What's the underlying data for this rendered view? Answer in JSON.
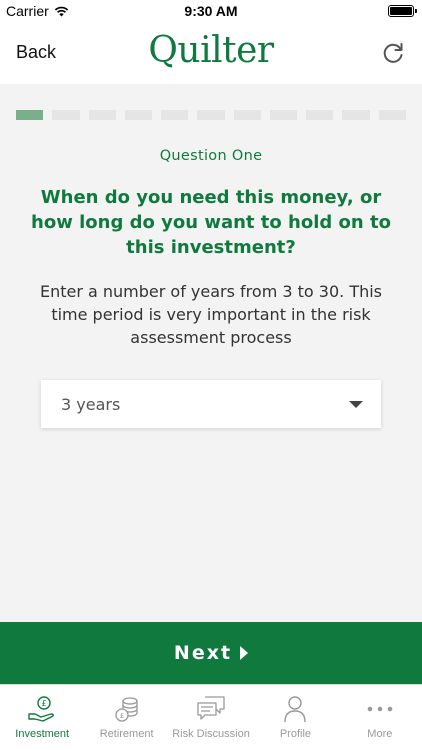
{
  "status_bar": {
    "carrier": "Carrier",
    "time": "9:30 AM"
  },
  "nav": {
    "back_label": "Back",
    "logo_text": "Quilter",
    "refresh_icon": "refresh-icon"
  },
  "progress": {
    "total_steps": 11,
    "current_step": 1
  },
  "question": {
    "label": "Question One",
    "title": "When do you need this money, or how long do you want to hold on to this investment?",
    "instruction": "Enter a number of years from 3 to 30. This time period is very important in the risk assessment process"
  },
  "dropdown": {
    "selected_value": "3 years"
  },
  "next_button": {
    "label": "Next"
  },
  "tabs": [
    {
      "label": "Investment",
      "icon": "investment-icon",
      "active": true
    },
    {
      "label": "Retirement",
      "icon": "retirement-coins-icon",
      "active": false
    },
    {
      "label": "Risk Discussion",
      "icon": "chat-icon",
      "active": false
    },
    {
      "label": "Profile",
      "icon": "profile-icon",
      "active": false
    },
    {
      "label": "More",
      "icon": "more-icon",
      "active": false
    }
  ],
  "colors": {
    "brand": "#107a3e",
    "progress_active": "#7aaf8b",
    "progress_inactive": "#e5e5e5",
    "background": "#f3f3f3",
    "inactive_tab": "#999999"
  }
}
